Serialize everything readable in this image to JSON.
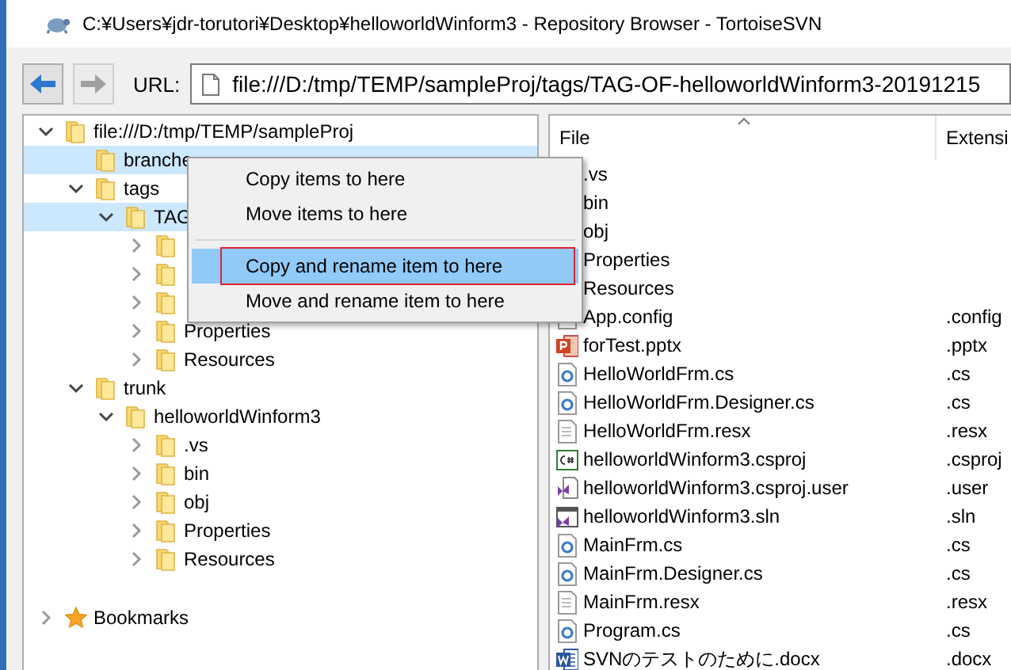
{
  "window": {
    "title": "C:¥Users¥jdr-torutori¥Desktop¥helloworldWinform3 - Repository Browser - TortoiseSVN"
  },
  "toolbar": {
    "back": {
      "disabled": false
    },
    "forward": {
      "disabled": true
    },
    "url_label": "URL:",
    "url": "file:///D:/tmp/TEMP/sampleProj/tags/TAG-OF-helloworldWinform3-20191215"
  },
  "tree": {
    "items": [
      {
        "label": "file:///D:/tmp/TEMP/sampleProj",
        "expanded": true,
        "selected": false,
        "children": [
          {
            "label": "branche",
            "selected": true
          },
          {
            "label": "tags",
            "expanded": true,
            "selected": false,
            "children": [
              {
                "label": "TAG",
                "expanded": true,
                "selected": true,
                "children": [
                  {
                    "expanded": false,
                    "selected": false
                  },
                  {
                    "expanded": false,
                    "selected": false
                  },
                  {
                    "expanded": false,
                    "selected": false
                  },
                  {
                    "label": "Properties",
                    "expanded": false,
                    "selected": false
                  },
                  {
                    "label": "Resources",
                    "expanded": false,
                    "selected": false
                  }
                ]
              }
            ]
          },
          {
            "label": "trunk",
            "expanded": true,
            "selected": false,
            "children": [
              {
                "label": "helloworldWinform3",
                "expanded": true,
                "selected": false,
                "children": [
                  {
                    "label": ".vs",
                    "expanded": false,
                    "selected": false
                  },
                  {
                    "label": "bin",
                    "expanded": false,
                    "selected": false
                  },
                  {
                    "label": "obj",
                    "expanded": false,
                    "selected": false
                  },
                  {
                    "label": "Properties",
                    "expanded": false,
                    "selected": false
                  },
                  {
                    "label": "Resources",
                    "expanded": false,
                    "selected": false
                  }
                ]
              }
            ]
          }
        ]
      }
    ],
    "bookmarks": {
      "label": "Bookmarks",
      "expanded": false
    }
  },
  "files": {
    "columns": [
      "File",
      "Extensi"
    ],
    "rows": [
      {
        "kind": "folder",
        "name": ".vs"
      },
      {
        "kind": "folder",
        "name": "bin"
      },
      {
        "kind": "folder",
        "name": "obj"
      },
      {
        "kind": "folder",
        "name": "Properties"
      },
      {
        "kind": "folder",
        "name": "Resources"
      },
      {
        "kind": "text",
        "name": "App.config",
        "ext": ".config"
      },
      {
        "kind": "pptx",
        "name": "forTest.pptx",
        "ext": ".pptx"
      },
      {
        "kind": "cs",
        "name": "HelloWorldFrm.cs",
        "ext": ".cs"
      },
      {
        "kind": "cs",
        "name": "HelloWorldFrm.Designer.cs",
        "ext": ".cs"
      },
      {
        "kind": "text",
        "name": "HelloWorldFrm.resx",
        "ext": ".resx"
      },
      {
        "kind": "csproj",
        "name": "helloworldWinform3.csproj",
        "ext": ".csproj"
      },
      {
        "kind": "vsuser",
        "name": "helloworldWinform3.csproj.user",
        "ext": ".user"
      },
      {
        "kind": "sln",
        "name": "helloworldWinform3.sln",
        "ext": ".sln"
      },
      {
        "kind": "cs",
        "name": "MainFrm.cs",
        "ext": ".cs"
      },
      {
        "kind": "cs",
        "name": "MainFrm.Designer.cs",
        "ext": ".cs"
      },
      {
        "kind": "text",
        "name": "MainFrm.resx",
        "ext": ".resx"
      },
      {
        "kind": "cs",
        "name": "Program.cs",
        "ext": ".cs"
      },
      {
        "kind": "docx",
        "name": "SVNのテストのために.docx",
        "ext": ".docx"
      }
    ]
  },
  "context_menu": {
    "items": [
      {
        "label": "Copy items to here",
        "selected": false,
        "outlined": false
      },
      {
        "label": "Move items to here",
        "selected": false,
        "outlined": false
      },
      {
        "kind": "separator"
      },
      {
        "label": "Copy and rename item to here",
        "selected": true,
        "outlined": true
      },
      {
        "label": "Move and rename item to here",
        "selected": false,
        "outlined": false
      }
    ]
  }
}
